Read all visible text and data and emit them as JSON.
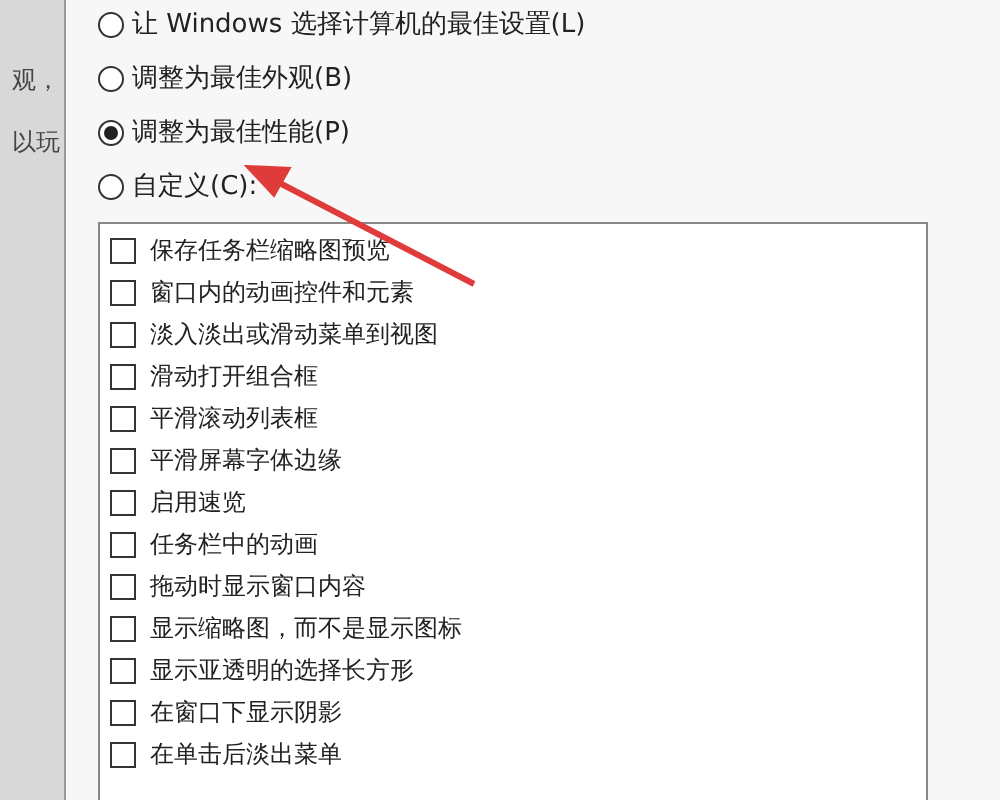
{
  "background_page": {
    "lines": [
      "观，",
      "以玩"
    ]
  },
  "options": [
    {
      "label": "让 Windows 选择计算机的最佳设置(L)",
      "selected": false
    },
    {
      "label": "调整为最佳外观(B)",
      "selected": false
    },
    {
      "label": "调整为最佳性能(P)",
      "selected": true
    },
    {
      "label": "自定义(C):",
      "selected": false
    }
  ],
  "effects": [
    {
      "label": "保存任务栏缩略图预览",
      "checked": false
    },
    {
      "label": "窗口内的动画控件和元素",
      "checked": false
    },
    {
      "label": "淡入淡出或滑动菜单到视图",
      "checked": false
    },
    {
      "label": "滑动打开组合框",
      "checked": false
    },
    {
      "label": "平滑滚动列表框",
      "checked": false
    },
    {
      "label": "平滑屏幕字体边缘",
      "checked": false
    },
    {
      "label": "启用速览",
      "checked": false
    },
    {
      "label": "任务栏中的动画",
      "checked": false
    },
    {
      "label": "拖动时显示窗口内容",
      "checked": false
    },
    {
      "label": "显示缩略图，而不是显示图标",
      "checked": false
    },
    {
      "label": "显示亚透明的选择长方形",
      "checked": false
    },
    {
      "label": "在窗口下显示阴影",
      "checked": false
    },
    {
      "label": "在单击后淡出菜单",
      "checked": false
    }
  ]
}
